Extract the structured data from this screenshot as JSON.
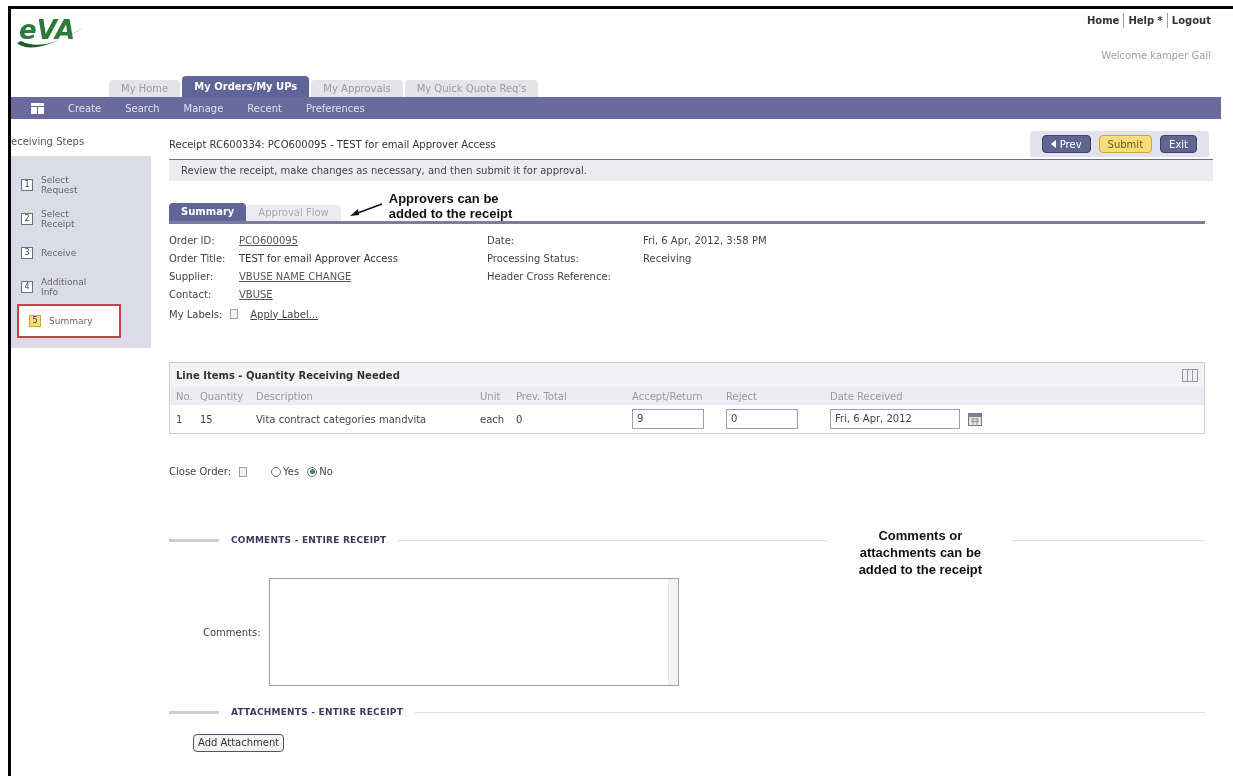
{
  "header": {
    "logo": "eVA",
    "util_links": [
      "Home",
      "Help *",
      "Logout"
    ],
    "welcome": "Welcome kamper Gail",
    "tabs": [
      {
        "label": "My Home",
        "selected": false
      },
      {
        "label": "My Orders/My UPs",
        "selected": true
      },
      {
        "label": "My Approvals",
        "selected": false
      },
      {
        "label": "My Quick Quote Req's",
        "selected": false
      }
    ],
    "nav": [
      "Create",
      "Search",
      "Manage",
      "Recent",
      "Preferences"
    ]
  },
  "sidebar": {
    "title": "eceiving Steps",
    "steps": [
      {
        "number": "1",
        "label": "Select Request",
        "selected": false
      },
      {
        "number": "2",
        "label": "Select Receipt",
        "selected": false
      },
      {
        "number": "3",
        "label": "Receive",
        "selected": false
      },
      {
        "number": "4",
        "label": "Additional Info",
        "selected": false
      },
      {
        "number": "5",
        "label": "Summary",
        "selected": true
      }
    ]
  },
  "page_title": "Receipt RC600334: PCO600095 - TEST for email Approver Access",
  "buttons": [
    {
      "label": "Prev",
      "kind": "prev"
    },
    {
      "label": "Submit",
      "kind": "primary"
    },
    {
      "label": "Exit",
      "kind": "plain"
    }
  ],
  "instruction": "Review the receipt, make changes as necessary, and then submit it for approval.",
  "subtabs": [
    {
      "label": "Summary",
      "selected": true
    },
    {
      "label": "Approval Flow",
      "selected": false
    }
  ],
  "callouts": [
    "Approvers can be added to the receipt",
    "Comments or attachments can be added to the receipt"
  ],
  "details_left": [
    {
      "label": "Order ID:",
      "value": "PCO600095",
      "link": true
    },
    {
      "label": "Order Title:",
      "value": "TEST for email Approver Access",
      "link": false
    },
    {
      "label": "Supplier:",
      "value": "VBUSE NAME CHANGE",
      "link": true
    },
    {
      "label": "Contact:",
      "value": "VBUSE",
      "link": true
    }
  ],
  "details_right": [
    {
      "label": "Date:",
      "value": "Fri, 6 Apr, 2012, 3:58 PM"
    },
    {
      "label": "Processing Status:",
      "value": "Receiving"
    },
    {
      "label": "Header Cross Reference:"
    }
  ],
  "labels": {
    "label": "My Labels:",
    "link": "Apply Label..."
  },
  "line_items": {
    "title": "Line Items - Quantity Receiving Needed",
    "columns": [
      "No.",
      "Quantity",
      "Description",
      "Unit",
      "Prev. Total",
      "Accept/Return",
      "Reject",
      "Date Received"
    ],
    "rows": [
      [
        {
          "kind": "text",
          "value": "1"
        },
        {
          "kind": "text",
          "value": "15"
        },
        {
          "kind": "text",
          "value": "Vita contract categories mandvita"
        },
        {
          "kind": "text",
          "value": "each"
        },
        {
          "kind": "text",
          "value": "0"
        },
        {
          "kind": "input",
          "value": "9"
        },
        {
          "kind": "input",
          "value": "0"
        },
        {
          "kind": "date",
          "value": "Fri, 6 Apr, 2012"
        }
      ]
    ]
  },
  "close_order": {
    "label": "Close Order:",
    "options": [
      {
        "label": "Yes",
        "selected": false
      },
      {
        "label": "No",
        "selected": true
      }
    ]
  },
  "comments": {
    "heading": "COMMENTS - ENTIRE RECEIPT",
    "label": "Comments:"
  },
  "attachments": {
    "heading": "ATTACHMENTS - ENTIRE RECEIPT",
    "button": "Add Attachment"
  }
}
